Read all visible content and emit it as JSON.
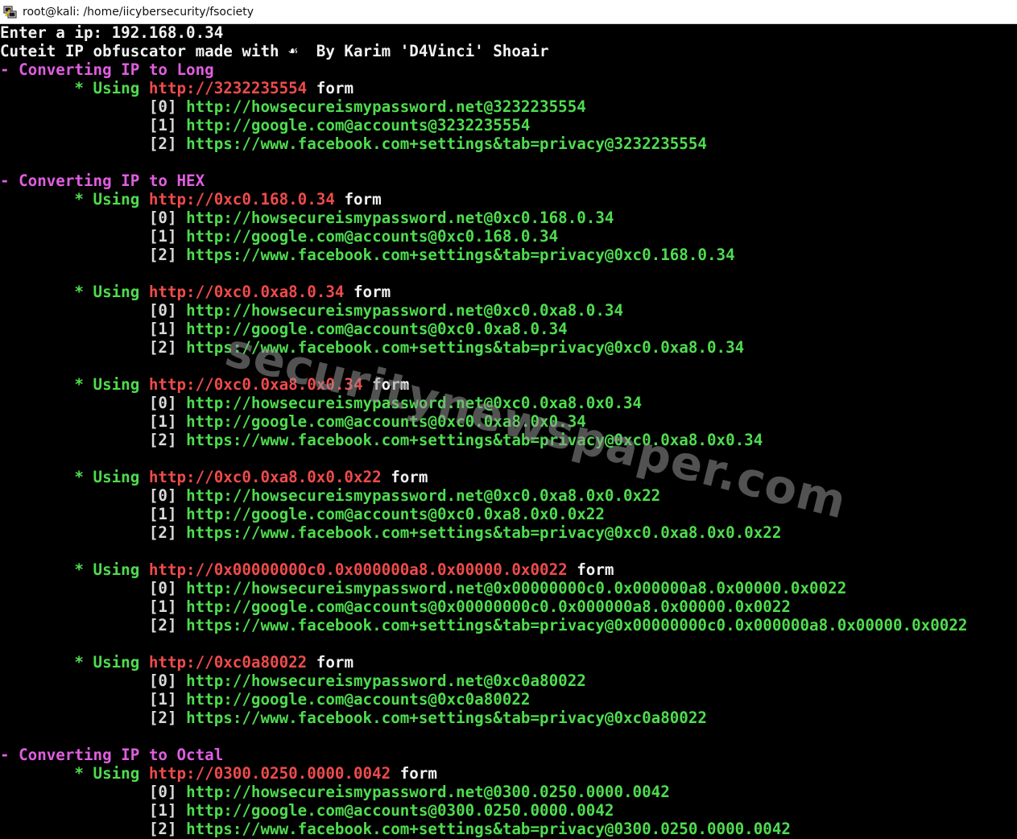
{
  "window": {
    "title": "root@kali: /home/iicybersecurity/fsociety",
    "icon": "putty-terminal-icon"
  },
  "terminal": {
    "prompt": {
      "label": "Enter a ip: ",
      "value": "192.168.0.34"
    },
    "banner": "Cuteit IP obfuscator made with ☙  By Karim 'D4Vinci' Shoair",
    "sections": [
      {
        "header": "- Converting IP to Long",
        "forms": [
          {
            "using": "* Using ",
            "url": "http://3232235554",
            "suffix": " form",
            "links": [
              {
                "idx": "[0] ",
                "url": "http://howsecureismypassword.net@3232235554"
              },
              {
                "idx": "[1] ",
                "url": "http://google.com@accounts@3232235554"
              },
              {
                "idx": "[2] ",
                "url": "https://www.facebook.com+settings&tab=privacy@3232235554"
              }
            ]
          }
        ]
      },
      {
        "header": "- Converting IP to HEX",
        "forms": [
          {
            "using": "* Using ",
            "url": "http://0xc0.168.0.34",
            "suffix": " form",
            "links": [
              {
                "idx": "[0] ",
                "url": "http://howsecureismypassword.net@0xc0.168.0.34"
              },
              {
                "idx": "[1] ",
                "url": "http://google.com@accounts@0xc0.168.0.34"
              },
              {
                "idx": "[2] ",
                "url": "https://www.facebook.com+settings&tab=privacy@0xc0.168.0.34"
              }
            ]
          },
          {
            "using": "* Using ",
            "url": "http://0xc0.0xa8.0.34",
            "suffix": " form",
            "links": [
              {
                "idx": "[0] ",
                "url": "http://howsecureismypassword.net@0xc0.0xa8.0.34"
              },
              {
                "idx": "[1] ",
                "url": "http://google.com@accounts@0xc0.0xa8.0.34"
              },
              {
                "idx": "[2] ",
                "url": "https://www.facebook.com+settings&tab=privacy@0xc0.0xa8.0.34"
              }
            ]
          },
          {
            "using": "* Using ",
            "url": "http://0xc0.0xa8.0x0.34",
            "suffix": " form",
            "links": [
              {
                "idx": "[0] ",
                "url": "http://howsecureismypassword.net@0xc0.0xa8.0x0.34"
              },
              {
                "idx": "[1] ",
                "url": "http://google.com@accounts@0xc0.0xa8.0x0.34"
              },
              {
                "idx": "[2] ",
                "url": "https://www.facebook.com+settings&tab=privacy@0xc0.0xa8.0x0.34"
              }
            ]
          },
          {
            "using": "* Using ",
            "url": "http://0xc0.0xa8.0x0.0x22",
            "suffix": " form",
            "links": [
              {
                "idx": "[0] ",
                "url": "http://howsecureismypassword.net@0xc0.0xa8.0x0.0x22"
              },
              {
                "idx": "[1] ",
                "url": "http://google.com@accounts@0xc0.0xa8.0x0.0x22"
              },
              {
                "idx": "[2] ",
                "url": "https://www.facebook.com+settings&tab=privacy@0xc0.0xa8.0x0.0x22"
              }
            ]
          },
          {
            "using": "* Using ",
            "url": "http://0x00000000c0.0x000000a8.0x00000.0x0022",
            "suffix": " form",
            "links": [
              {
                "idx": "[0] ",
                "url": "http://howsecureismypassword.net@0x00000000c0.0x000000a8.0x00000.0x0022"
              },
              {
                "idx": "[1] ",
                "url": "http://google.com@accounts@0x00000000c0.0x000000a8.0x00000.0x0022"
              },
              {
                "idx": "[2] ",
                "url": "https://www.facebook.com+settings&tab=privacy@0x00000000c0.0x000000a8.0x00000.0x0022"
              }
            ]
          },
          {
            "using": "* Using ",
            "url": "http://0xc0a80022",
            "suffix": " form",
            "links": [
              {
                "idx": "[0] ",
                "url": "http://howsecureismypassword.net@0xc0a80022"
              },
              {
                "idx": "[1] ",
                "url": "http://google.com@accounts@0xc0a80022"
              },
              {
                "idx": "[2] ",
                "url": "https://www.facebook.com+settings&tab=privacy@0xc0a80022"
              }
            ]
          }
        ]
      },
      {
        "header": "- Converting IP to Octal",
        "forms": [
          {
            "using": "* Using ",
            "url": "http://0300.0250.0000.0042",
            "suffix": " form",
            "links": [
              {
                "idx": "[0] ",
                "url": "http://howsecureismypassword.net@0300.0250.0000.0042"
              },
              {
                "idx": "[1] ",
                "url": "http://google.com@accounts@0300.0250.0000.0042"
              },
              {
                "idx": "[2] ",
                "url": "https://www.facebook.com+settings&tab=privacy@0300.0250.0000.0042"
              }
            ]
          }
        ]
      }
    ]
  },
  "watermark": "securitynewspaper.com",
  "colors": {
    "background": "#000000",
    "text": "#f2f2f2",
    "header": "#e05ee0",
    "link": "#4fdc4f",
    "form_url": "#ef4b4b"
  }
}
